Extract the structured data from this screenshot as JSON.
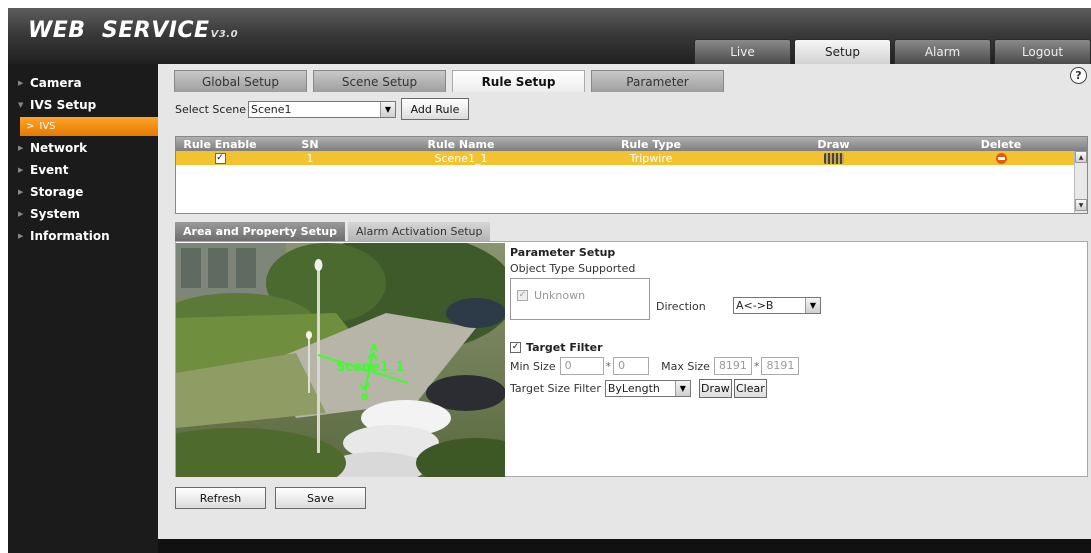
{
  "header": {
    "logo_text": "WEB  SERVICE",
    "logo_version": "V3.0",
    "tabs": [
      {
        "label": "Live",
        "active": false
      },
      {
        "label": "Setup",
        "active": true
      },
      {
        "label": "Alarm",
        "active": false
      },
      {
        "label": "Logout",
        "active": false
      }
    ]
  },
  "sidebar": {
    "items": [
      {
        "label": "Camera"
      },
      {
        "label": "IVS Setup"
      },
      {
        "label": "IVS"
      },
      {
        "label": "Network"
      },
      {
        "label": "Event"
      },
      {
        "label": "Storage"
      },
      {
        "label": "System"
      },
      {
        "label": "Information"
      }
    ],
    "sub_arrow": ">"
  },
  "main": {
    "help_glyph": "?",
    "tabs": [
      {
        "label": "Global Setup"
      },
      {
        "label": "Scene Setup"
      },
      {
        "label": "Rule Setup"
      },
      {
        "label": "Parameter"
      }
    ],
    "select_scene_label": "Select Scene",
    "select_scene_value": "Scene1",
    "add_rule_label": "Add Rule",
    "rule_table": {
      "headers": [
        "Rule Enable",
        "SN",
        "Rule Name",
        "Rule Type",
        "Draw",
        "Delete"
      ],
      "rows": [
        {
          "enabled_mark": "✓",
          "sn": "1",
          "name": "Scene1_1",
          "type": "Tripwire"
        }
      ]
    },
    "lower_tabs": [
      {
        "label": "Area and Property Setup"
      },
      {
        "label": "Alarm Activation Setup"
      }
    ],
    "video_overlay": {
      "rule_label": "Scene1_1",
      "point_a": "A",
      "point_b": "B"
    },
    "params": {
      "title": "Parameter Setup",
      "object_type_label": "Object Type Supported",
      "object_option": "Unknown",
      "direction_label": "Direction",
      "direction_value": "A<->B",
      "target_filter_label": "Target Filter",
      "min_size_label": "Min Size",
      "min_w": "0",
      "min_h": "0",
      "max_size_label": "Max Size",
      "max_w": "8191",
      "max_h": "8191",
      "size_sep": "*",
      "target_size_filter_label": "Target Size Filter",
      "target_size_filter_value": "ByLength",
      "draw_label": "Draw",
      "clear_label": "Clear"
    },
    "refresh_label": "Refresh",
    "save_label": "Save"
  },
  "colors": {
    "accent_orange": "#f28c0f",
    "row_highlight": "#f2c230",
    "overlay_green": "#3bff2b"
  }
}
